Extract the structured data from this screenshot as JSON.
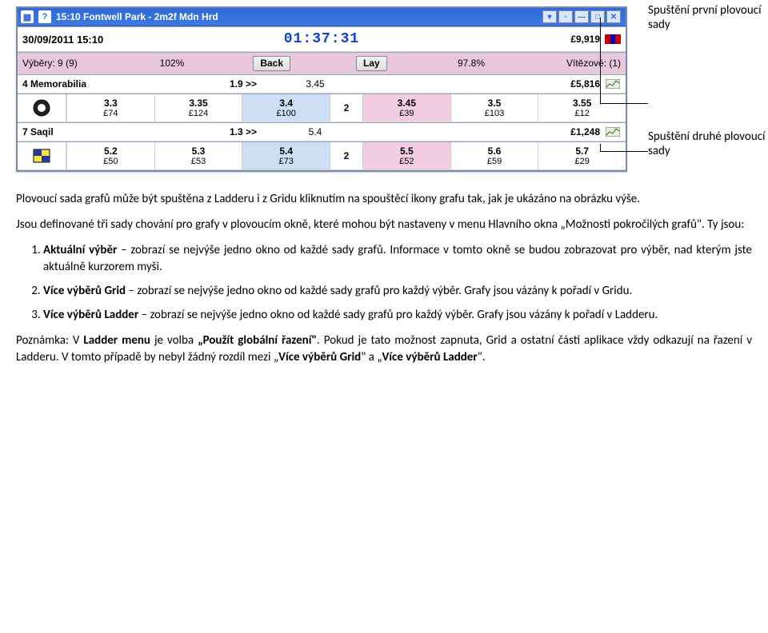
{
  "annotations": {
    "first": "Spuštění první plovoucí sady",
    "second": "Spuštění druhé plovoucí sady"
  },
  "titlebar": {
    "title": "15:10 Fontwell Park - 2m2f Mdn Hrd"
  },
  "dateRow": {
    "datetime": "30/09/2011  15:10",
    "clock": "01:37:31",
    "value": "£9,919"
  },
  "statsRow": {
    "selections": "Výběry: 9 (9)",
    "backPct": "102%",
    "backLabel": "Back",
    "layLabel": "Lay",
    "layPct": "97.8%",
    "winners": "Vítězové: (1)"
  },
  "runners": [
    {
      "name": "4 Memorabilia",
      "backPrice": "1.9 >>",
      "layPrice": "3.45",
      "matched": "£5,816",
      "prices": [
        {
          "o": "3.3",
          "s": "£74"
        },
        {
          "o": "3.35",
          "s": "£124"
        },
        {
          "o": "3.4",
          "s": "£100"
        },
        {
          "o": "2",
          "s": ""
        },
        {
          "o": "3.45",
          "s": "£39"
        },
        {
          "o": "3.5",
          "s": "£103"
        },
        {
          "o": "3.55",
          "s": "£12"
        }
      ]
    },
    {
      "name": "7 Saqil",
      "backPrice": "1.3 >>",
      "layPrice": "5.4",
      "matched": "£1,248",
      "prices": [
        {
          "o": "5.2",
          "s": "£50"
        },
        {
          "o": "5.3",
          "s": "£53"
        },
        {
          "o": "5.4",
          "s": "£73"
        },
        {
          "o": "2",
          "s": ""
        },
        {
          "o": "5.5",
          "s": "£52"
        },
        {
          "o": "5.6",
          "s": "£59"
        },
        {
          "o": "5.7",
          "s": "£29"
        }
      ]
    }
  ],
  "text": {
    "p1a": "Plovoucí sada grafů může být spuštěna z Ladderu i z Gridu kliknutím na spouštěcí ikony grafu tak, jak je ukázáno na obrázku výše.",
    "p2a": "Jsou definované tři sady chování pro grafy v plovoucím okně, které mohou být nastaveny v menu Hlavního okna „Možnosti pokročilých grafů\". Ty jsou:",
    "li1b": "Aktuální výběr",
    "li1": " – zobrazí se nejvýše jedno okno od každé sady grafů. Informace v tomto okně se budou zobrazovat pro výběr, nad kterým jste aktuálně kurzorem myši.",
    "li2b": "Více výběrů Grid",
    "li2": " – zobrazí se nejvýše jedno okno od každé sady grafů pro každý výběr. Grafy jsou vázány k pořadí v Gridu.",
    "li3b": "Více výběrů Ladder",
    "li3": " – zobrazí se nejvýše jedno okno od každé sady grafů pro každý výběr. Grafy jsou vázány k pořadí v Ladderu.",
    "p3a": "Poznámka: V ",
    "p3b": "Ladder menu",
    "p3c": " je volba ",
    "p3d": "„Použít globální řazení\"",
    "p3e": ". Pokud je tato možnost zapnuta, Grid a ostatní části aplikace vždy odkazují na řazení v Ladderu. V tomto případě by nebyl žádný rozdíl mezi „",
    "p3f": "Více výběrů Grid",
    "p3g": "\" a „",
    "p3h": "Více výběrů Ladder",
    "p3i": "\"."
  }
}
